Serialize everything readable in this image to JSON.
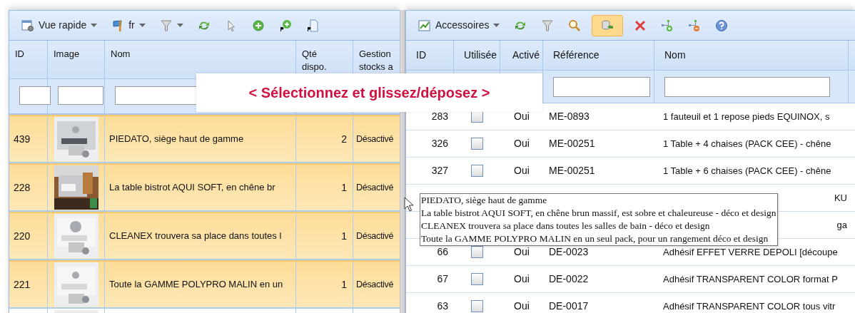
{
  "left_panel": {
    "toolbar": [
      {
        "kind": "view",
        "label": "Vue rapide",
        "dropdown": true,
        "active": false
      },
      {
        "kind": "flag",
        "label": "fr",
        "dropdown": true,
        "active": false
      },
      {
        "kind": "filter",
        "dropdown": true,
        "active": false
      },
      {
        "kind": "refresh",
        "dropdown": false,
        "active": false
      },
      {
        "kind": "pointer",
        "dropdown": false,
        "active": false
      },
      {
        "kind": "add",
        "dropdown": false,
        "active": false
      },
      {
        "kind": "add-p",
        "dropdown": false,
        "active": false
      },
      {
        "kind": "doc-p",
        "dropdown": false,
        "active": false
      }
    ],
    "columns": [
      {
        "label": "ID",
        "filter": true
      },
      {
        "label": "Image",
        "filter": true
      },
      {
        "label": "Nom",
        "filter": true
      },
      {
        "label": "Qté\ndispo.",
        "filter": false
      },
      {
        "label": "Gestion\nstocks a",
        "filter": false
      }
    ],
    "rows": [
      {
        "id": "439",
        "name": "PIEDATO, siège haut de gamme",
        "qty": "2",
        "stock": "Désactivé",
        "selected": true
      },
      {
        "id": "228",
        "name": "La table bistrot AQUI SOFT, en chêne br",
        "qty": "1",
        "stock": "Désactivé",
        "selected": true
      },
      {
        "id": "220",
        "name": "CLEANEX trouvera sa place dans toutes l",
        "qty": "1",
        "stock": "Désactivé",
        "selected": true
      },
      {
        "id": "221",
        "name": "Toute la GAMME POLYPRO MALIN en un",
        "qty": "1",
        "stock": "Désactivé",
        "selected": true
      },
      {
        "selected": false
      }
    ]
  },
  "right_panel": {
    "toolbar": [
      {
        "kind": "chart",
        "label": "Accessoires",
        "dropdown": true,
        "active": false
      },
      {
        "kind": "refresh",
        "dropdown": false,
        "active": false
      },
      {
        "kind": "filter",
        "dropdown": false,
        "active": false
      },
      {
        "kind": "search",
        "dropdown": false,
        "active": false
      },
      {
        "kind": "db-refresh",
        "dropdown": false,
        "active": true
      },
      {
        "kind": "delete",
        "dropdown": false,
        "active": false
      },
      {
        "kind": "node-add",
        "dropdown": false,
        "active": false
      },
      {
        "kind": "node-remove",
        "dropdown": false,
        "active": false
      },
      {
        "kind": "help",
        "dropdown": false,
        "active": false
      }
    ],
    "columns": [
      {
        "label": "ID",
        "filter": false
      },
      {
        "label": "Utilisée",
        "filter": false
      },
      {
        "label": "Activé",
        "filter": false
      },
      {
        "label": "Référence",
        "filter": true
      },
      {
        "label": "Nom",
        "filter": true
      }
    ],
    "rows": [
      {
        "id": "283",
        "used": false,
        "active": "Oui",
        "ref": "ME-0893",
        "name": "1 fauteuil et 1 repose pieds EQUINOX, s"
      },
      {
        "id": "326",
        "used": false,
        "active": "Oui",
        "ref": "ME-00251",
        "name": "1 Table + 4 chaises (PACK CEE) - chêne"
      },
      {
        "id": "327",
        "used": false,
        "active": "Oui",
        "ref": "ME-00251",
        "name": "1 Table + 6 chaises (PACK CEE) - chêne"
      },
      {
        "name_tail": "KU"
      },
      {
        "name_tail": "ga"
      },
      {
        "id": "66",
        "used": false,
        "active": "Oui",
        "ref": "DE-0023",
        "name": "Adhésif EFFET VERRE DEPOLI [découpe"
      },
      {
        "id": "67",
        "used": false,
        "active": "Oui",
        "ref": "DE-0022",
        "name": "Adhésif TRANSPARENT COLOR format P"
      },
      {
        "id": "63",
        "used": false,
        "active": "Oui",
        "ref": "DE-0017",
        "name": "Adhésif TRANSPARENT COLOR tous vitr"
      }
    ]
  },
  "banner": "< Sélectionnez et glissez/déposez >",
  "tooltip": {
    "lines": [
      "PIEDATO, siège haut de gamme",
      "La table bistrot AQUI SOFT, en chêne brun massif, est sobre et chaleureuse - déco et design",
      "CLEANEX trouvera sa place dans toutes les salles de bain - déco et design",
      "Toute la GAMME POLYPRO MALIN en un seul pack, pour un rangement déco et design"
    ]
  }
}
